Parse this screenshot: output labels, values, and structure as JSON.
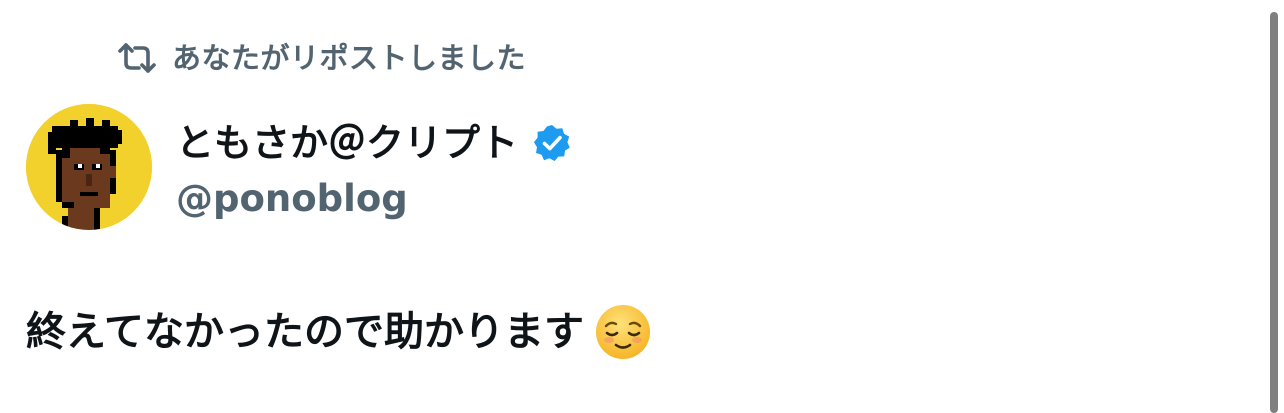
{
  "repost": {
    "icon": "repost-icon",
    "text": "あなたがリポストしました"
  },
  "author": {
    "avatar_icon": "pixel-avatar-icon",
    "display_name": "ともさか＠クリプト",
    "verified_icon": "verified-badge-icon",
    "handle": "@ponoblog"
  },
  "tweet": {
    "text": "終えてなかったので助かります",
    "emoji_icon": "relieved-face-emoji-icon"
  },
  "colors": {
    "text_primary": "#0f1419",
    "text_secondary": "#536471",
    "verified_blue": "#1d9bf0",
    "avatar_bg": "#f2d12c"
  }
}
